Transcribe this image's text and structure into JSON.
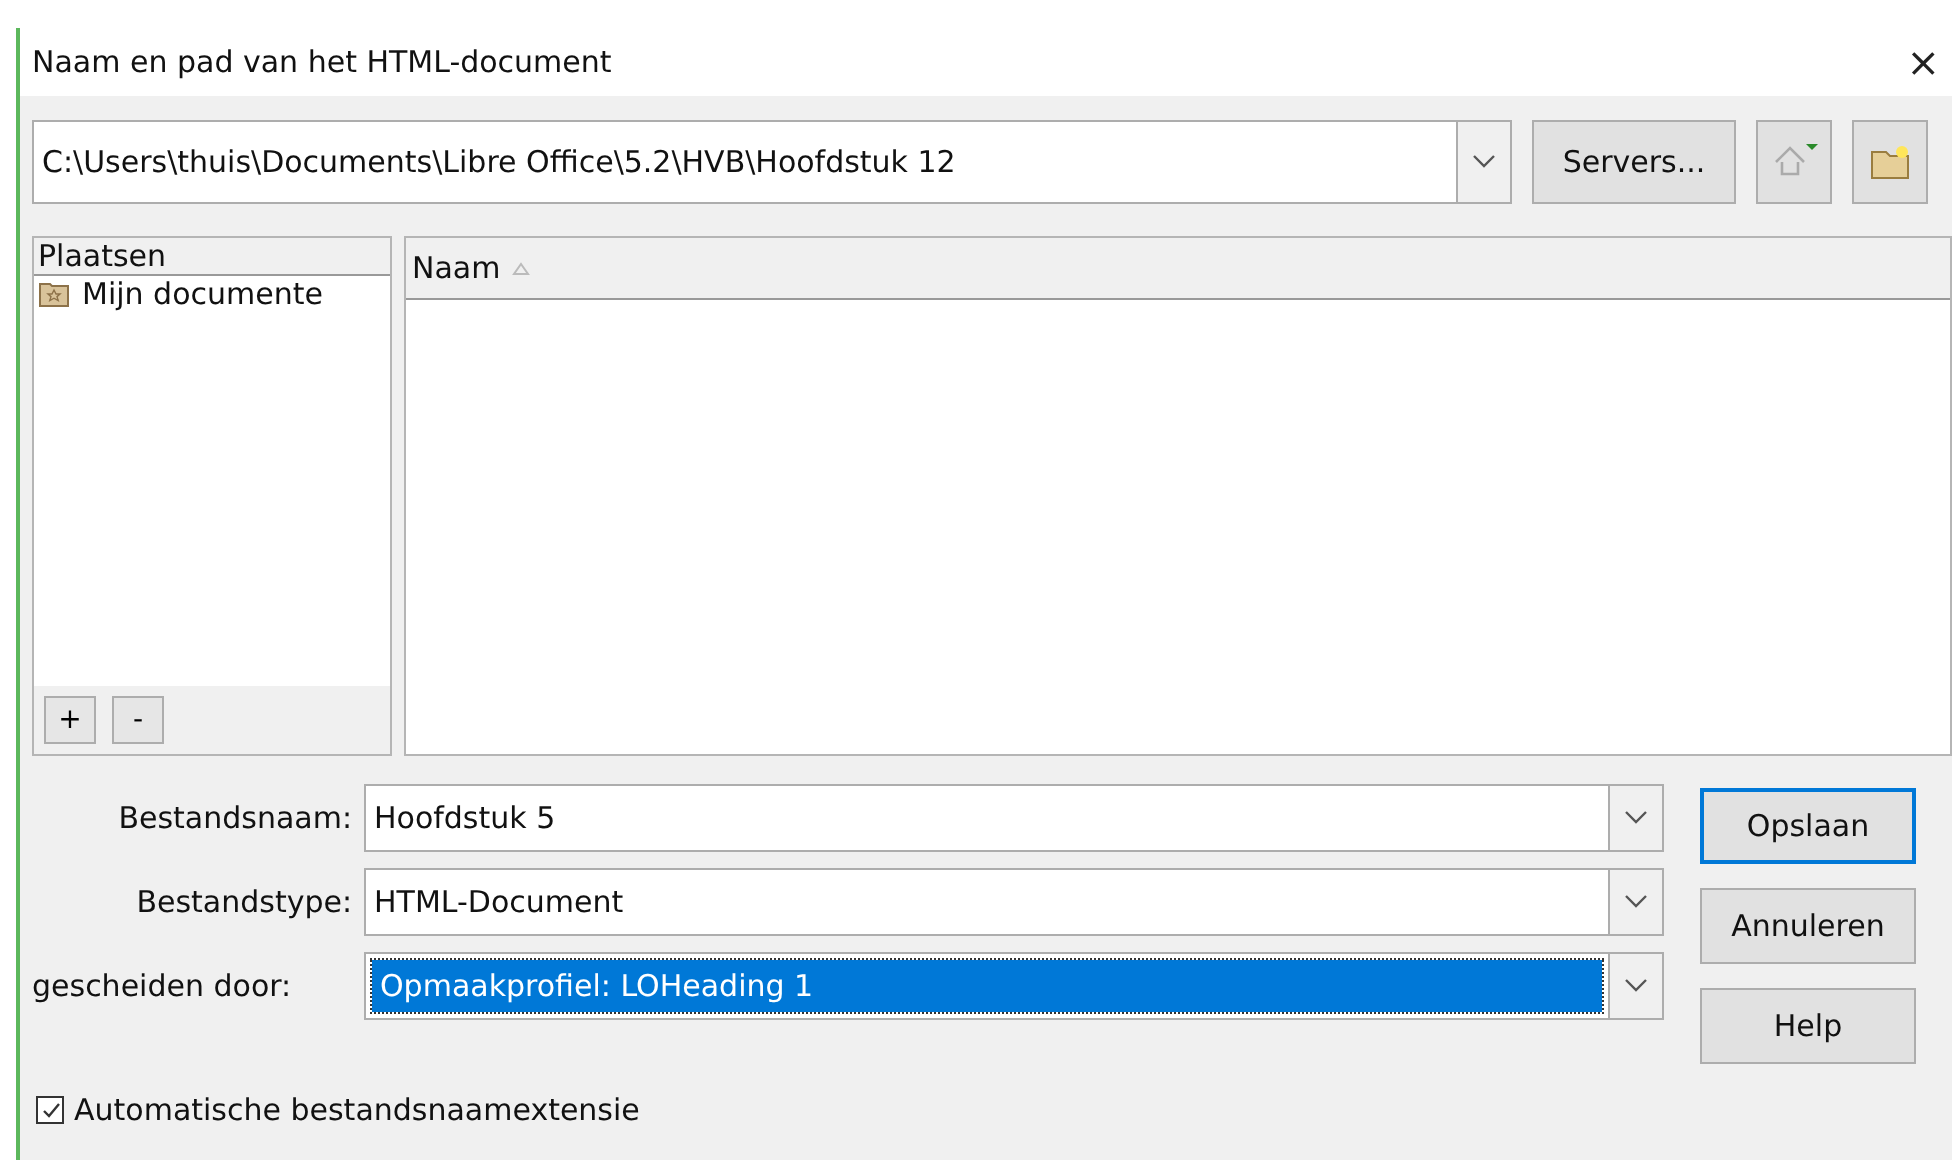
{
  "window": {
    "title": "Naam en pad van het HTML-document",
    "close": "×"
  },
  "path": {
    "value": "C:\\Users\\thuis\\Documents\\Libre Office\\5.2\\HVB\\Hoofdstuk 12"
  },
  "toolbar": {
    "servers": "Servers..."
  },
  "places": {
    "heading": "Plaatsen",
    "items": [
      {
        "label": "Mijn documente",
        "selected": false
      }
    ],
    "add": "+",
    "remove": "-"
  },
  "files": {
    "columns": [
      {
        "label": "Naam",
        "sorted": true
      }
    ]
  },
  "fields": [
    {
      "label": "Bestandsnaam:",
      "value": "Hoofdstuk 5",
      "highlighted": false
    },
    {
      "label": "Bestandstype:",
      "value": "HTML-Document",
      "highlighted": false
    },
    {
      "label": "gescheiden door:",
      "value": "Opmaakprofiel: LOHeading 1",
      "highlighted": true
    }
  ],
  "buttons": [
    {
      "label": "Opslaan",
      "default": true
    },
    {
      "label": "Annuleren",
      "default": false
    },
    {
      "label": "Help",
      "default": false
    }
  ],
  "auto_extension": {
    "label": "Automatische bestandsnaamextensie",
    "checked": true
  }
}
